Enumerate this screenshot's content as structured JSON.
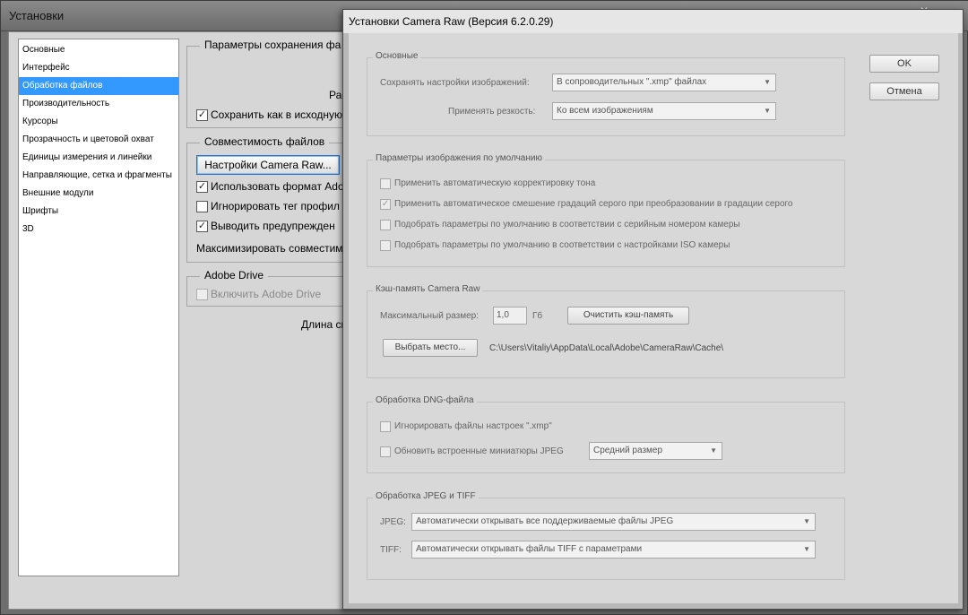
{
  "ps_window": {
    "title": "Установки",
    "sidebar_items": [
      "Основные",
      "Интерфейс",
      "Обработка файлов",
      "Производительность",
      "Курсоры",
      "Прозрачность и цветовой охват",
      "Единицы измерения и линейки",
      "Направляющие, сетка и фрагменты",
      "Внешние модули",
      "Шрифты",
      "3D"
    ],
    "active_sidebar_index": 2,
    "save_group_label": "Параметры сохранения фа",
    "save_partial": "Рас",
    "save_original_check": "✓",
    "save_original_label": "Сохранить как в исходную",
    "compat_group_label": "Совместимость файлов",
    "camera_raw_button": "Настройки Camera Raw...",
    "use_format_check": "✓",
    "use_format_label": "Использовать формат Adob",
    "ignore_tag_check": "",
    "ignore_tag_label": "Игнорировать тег профил",
    "warn_check": "✓",
    "warn_label": "Выводить предупрежден",
    "maximize_label": "Максимизировать совместим",
    "drive_group_label": "Adobe Drive",
    "drive_check": "",
    "drive_label": "Включить Adobe Drive",
    "length_label": "Длина сп"
  },
  "cr_dialog": {
    "title": "Установки Camera Raw  (Версия 6.2.0.29)",
    "ok_label": "OK",
    "cancel_label": "Отмена",
    "basic": {
      "label": "Основные",
      "save_settings_label": "Сохранять настройки изображений:",
      "save_settings_value": "В сопроводительных \".xmp\" файлах",
      "sharpen_label": "Применять резкость:",
      "sharpen_value": "Ко всем изображениям"
    },
    "defaults": {
      "label": "Параметры изображения по умолчанию",
      "items": [
        {
          "checked": "",
          "label": "Применить автоматическую корректировку тона"
        },
        {
          "checked": "✓",
          "label": "Применить автоматическое смешение градаций серого при преобразовании в градации серого"
        },
        {
          "checked": "",
          "label": "Подобрать параметры по умолчанию в соответствии с серийным номером камеры"
        },
        {
          "checked": "",
          "label": "Подобрать параметры по умолчанию в соответствии с настройками ISO камеры"
        }
      ]
    },
    "cache": {
      "label": "Кэш-память Camera Raw",
      "max_size_label": "Максимальный размер:",
      "max_size_value": "1,0",
      "unit": "Гб",
      "purge_button": "Очистить кэш-память",
      "select_button": "Выбрать место...",
      "path": "C:\\Users\\Vitaliy\\AppData\\Local\\Adobe\\CameraRaw\\Cache\\"
    },
    "dng": {
      "label": "Обработка DNG-файла",
      "ignore_label": "Игнорировать файлы настроек \".xmp\"",
      "update_label": "Обновить встроенные миниатюры JPEG",
      "preview_value": "Средний размер"
    },
    "jpeg_tiff": {
      "label": "Обработка JPEG и TIFF",
      "jpeg_label": "JPEG:",
      "jpeg_value": "Автоматически открывать все поддерживаемые файлы JPEG",
      "tiff_label": "TIFF:",
      "tiff_value": "Автоматически открывать файлы TIFF с параметрами"
    }
  }
}
